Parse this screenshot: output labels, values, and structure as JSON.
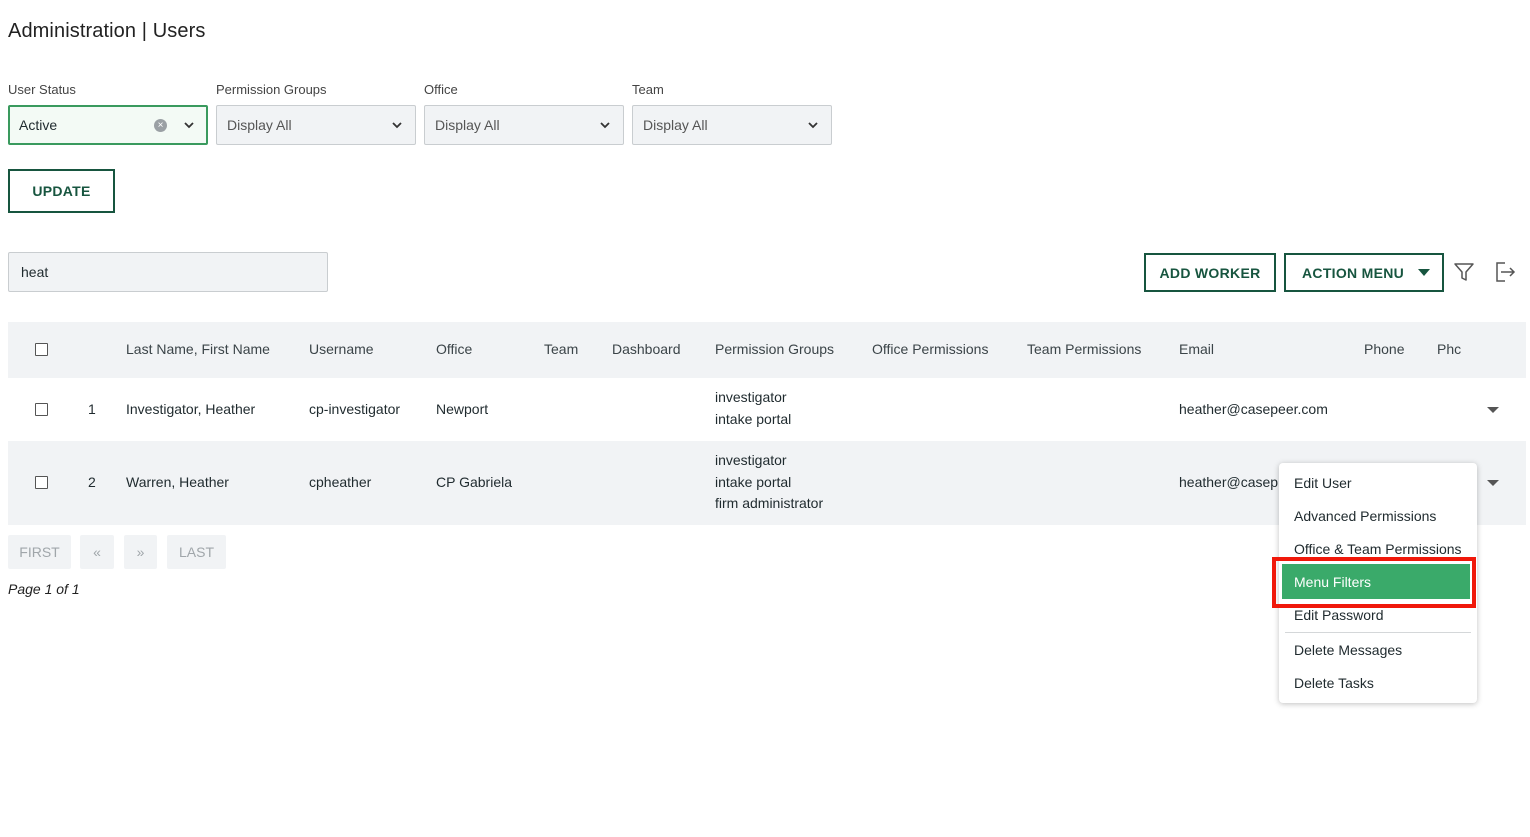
{
  "page": {
    "title": "Administration | Users"
  },
  "filters": {
    "user_status": {
      "label": "User Status",
      "value": "Active"
    },
    "permission_groups": {
      "label": "Permission Groups",
      "value": "Display All"
    },
    "office": {
      "label": "Office",
      "value": "Display All"
    },
    "team": {
      "label": "Team",
      "value": "Display All"
    },
    "update_label": "UPDATE"
  },
  "search": {
    "value": "heat"
  },
  "toolbar": {
    "add_worker": "ADD WORKER",
    "action_menu": "ACTION MENU",
    "filter_icon": "filter-icon",
    "export_icon": "export-icon"
  },
  "table": {
    "headers": [
      "Last Name, First Name",
      "Username",
      "Office",
      "Team",
      "Dashboard",
      "Permission Groups",
      "Office Permissions",
      "Team Permissions",
      "Email",
      "Phone",
      "Phc"
    ],
    "rows": [
      {
        "num": "1",
        "name": "Investigator, Heather",
        "username": "cp-investigator",
        "office": "Newport",
        "permissions": [
          "investigator",
          "intake portal"
        ],
        "email": "heather@casepeer.com"
      },
      {
        "num": "2",
        "name": "Warren, Heather",
        "username": "cpheather",
        "office": "CP Gabriela",
        "permissions": [
          "investigator",
          "intake portal",
          "firm administrator"
        ],
        "email": "heather@casep"
      }
    ]
  },
  "pagination": {
    "first": "FIRST",
    "prev": "«",
    "next": "»",
    "last": "LAST",
    "info": "Page 1 of 1"
  },
  "context_menu": {
    "items": [
      "Edit User",
      "Advanced Permissions",
      "Office & Team Permissions",
      "Menu Filters",
      "Edit Password",
      "Delete Messages",
      "Delete Tasks"
    ],
    "highlighted": "Menu Filters"
  },
  "colors": {
    "accent": "#17553f",
    "highlight": "#3aaa6a",
    "annotation": "#f0180a"
  }
}
